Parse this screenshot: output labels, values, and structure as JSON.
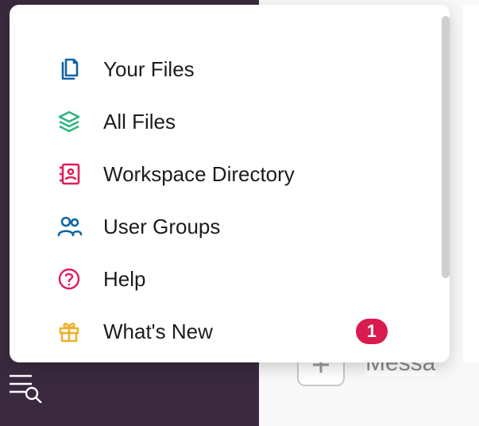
{
  "menu": {
    "items": [
      {
        "label": "Your Files"
      },
      {
        "label": "All Files"
      },
      {
        "label": "Workspace Directory"
      },
      {
        "label": "User Groups"
      },
      {
        "label": "Help"
      },
      {
        "label": "What's New",
        "badge": "1"
      }
    ]
  },
  "background": {
    "message_placeholder": "Messa"
  },
  "colors": {
    "file_icon": "#1264a3",
    "stack_icon": "#2eb67d",
    "directory_icon": "#e01e5a",
    "users_icon": "#1264a3",
    "help_icon": "#e01e5a",
    "gift_icon": "#ecb22e",
    "badge_bg": "#d91b4f"
  }
}
